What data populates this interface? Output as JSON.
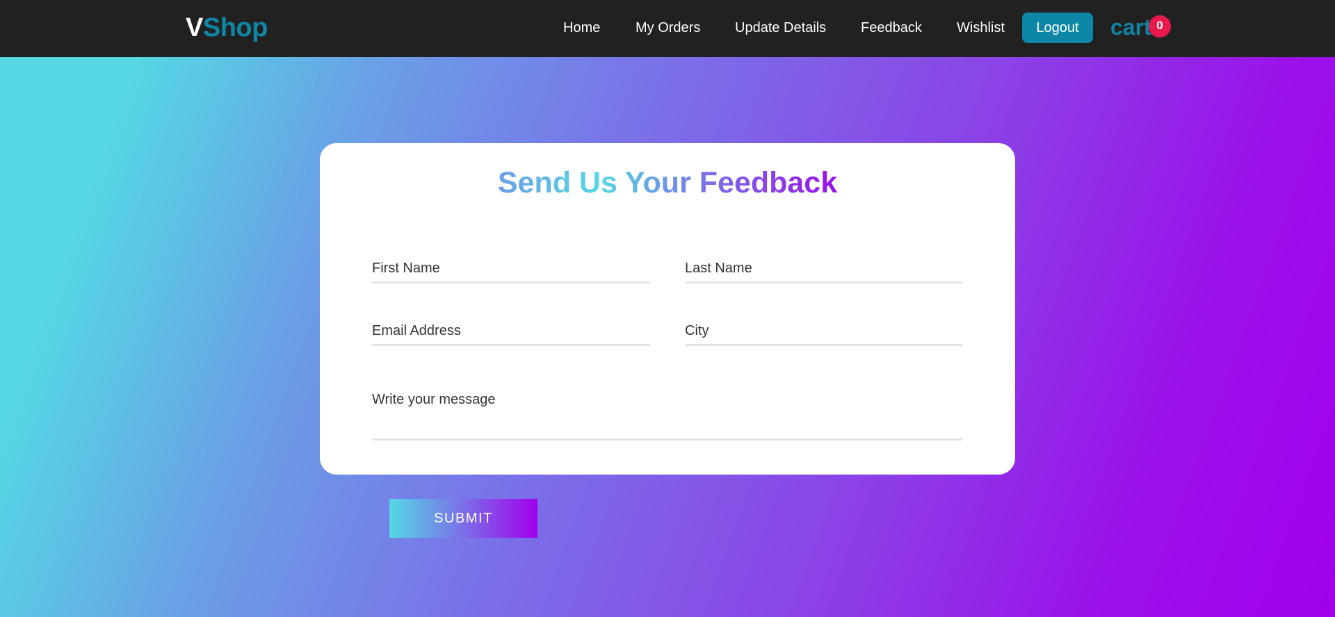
{
  "brand": {
    "first": "V",
    "rest": "Shop"
  },
  "nav": {
    "home": "Home",
    "orders": "My Orders",
    "update": "Update Details",
    "feedback": "Feedback",
    "wishlist": "Wishlist",
    "logout": "Logout",
    "cart": "cart",
    "cart_count": "0"
  },
  "form": {
    "title": "Send Us Your Feedback",
    "first_name_placeholder": "First Name",
    "last_name_placeholder": "Last Name",
    "email_placeholder": "Email Address",
    "city_placeholder": "City",
    "message_placeholder": "Write your message",
    "submit_label": "SUBMIT"
  },
  "colors": {
    "navbar": "#212121",
    "accent": "#0e86a6",
    "badge": "#e8194c",
    "gradient_start": "#55d8e4",
    "gradient_end": "#a100ec"
  }
}
